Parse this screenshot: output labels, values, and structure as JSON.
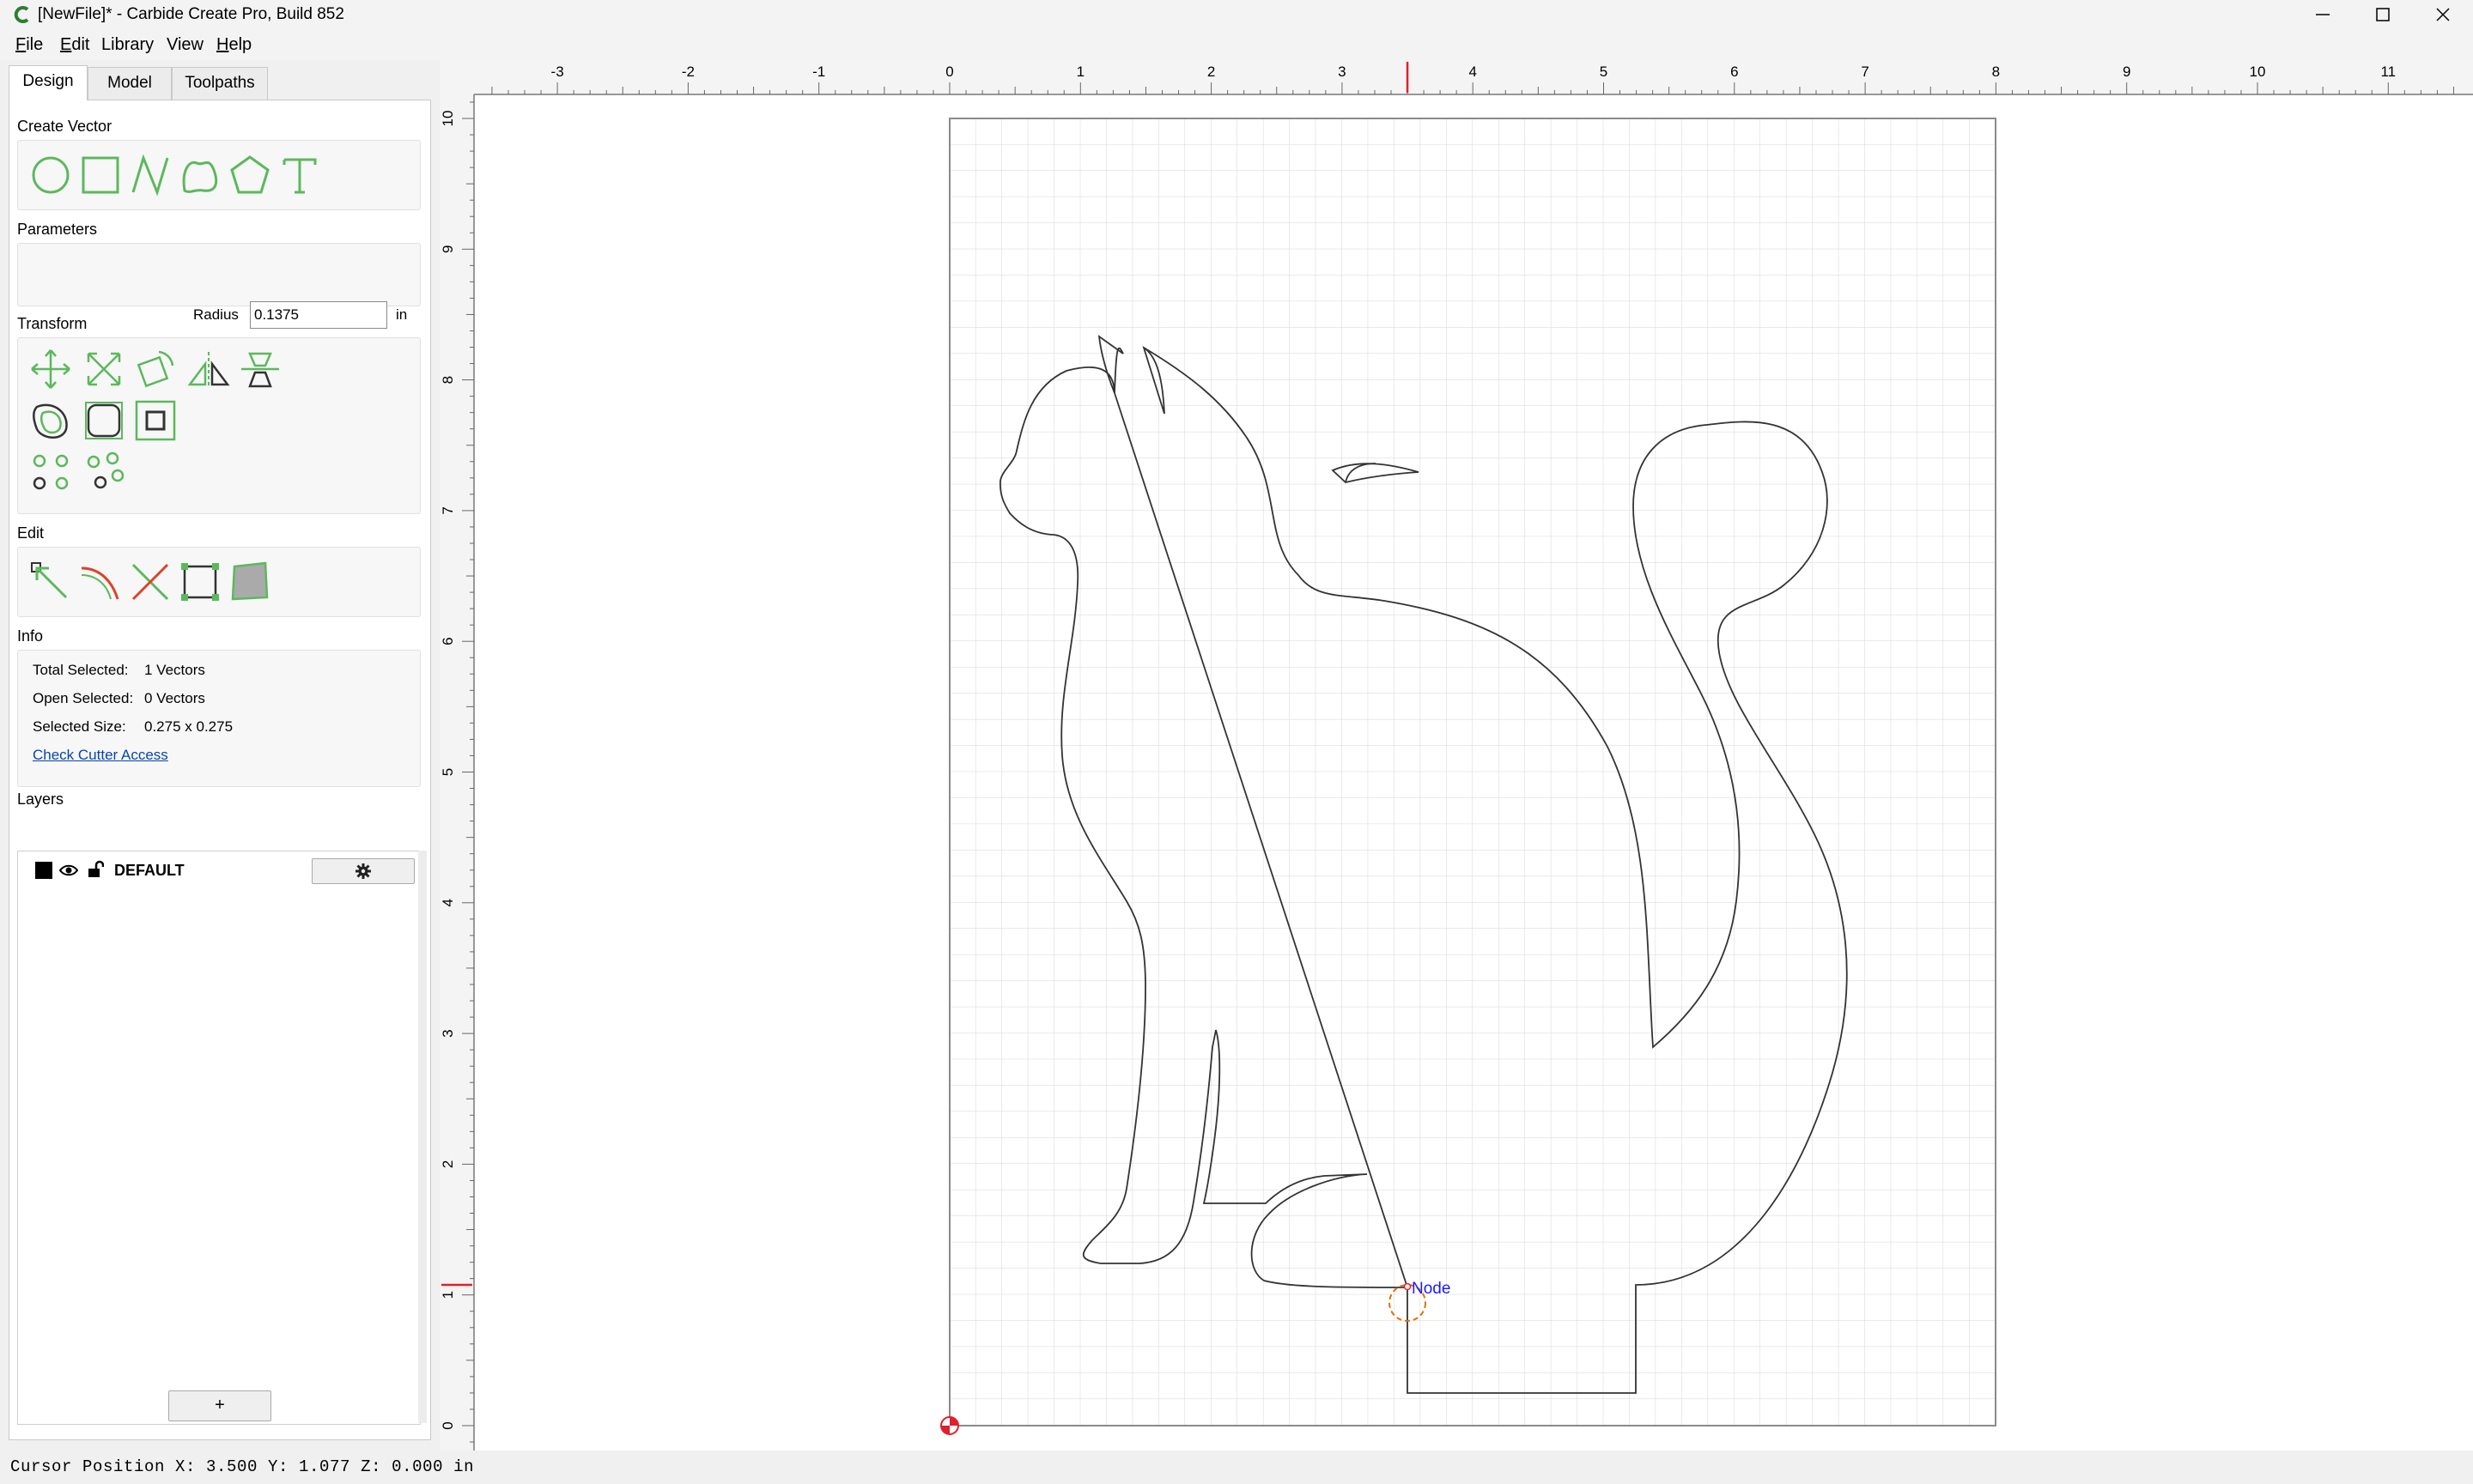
{
  "window": {
    "title": "[NewFile]* - Carbide Create Pro, Build 852"
  },
  "menu": [
    {
      "label": "File",
      "accel": "F",
      "rest": "ile"
    },
    {
      "label": "Edit",
      "accel": "E",
      "rest": "dit"
    },
    {
      "label": "Library",
      "accel": "",
      "rest": "Library"
    },
    {
      "label": "View",
      "accel": "",
      "rest": "View"
    },
    {
      "label": "Help",
      "accel": "H",
      "rest": "elp"
    }
  ],
  "tabs": [
    "Design",
    "Model",
    "Toolpaths"
  ],
  "sections": {
    "create_vector": "Create Vector",
    "parameters": "Parameters",
    "transform": "Transform",
    "edit": "Edit",
    "info": "Info",
    "layers": "Layers"
  },
  "create_vector_tools": [
    "circle-icon",
    "rectangle-icon",
    "polyline-icon",
    "curve-icon",
    "polygon-icon",
    "text-icon"
  ],
  "parameters": {
    "radius_label": "Radius",
    "radius_value": "0.1375",
    "unit": "in"
  },
  "transform_tools": [
    "move-icon",
    "scale-icon",
    "rotate-icon",
    "mirror-icon",
    "align-icon",
    "offset-icon",
    "fillet-icon",
    "boolean-icon",
    "array-icon",
    "circular-array-icon"
  ],
  "edit_tools": [
    "node-edit-icon",
    "trim-icon",
    "cut-icon",
    "bounding-box-icon",
    "smooth-icon"
  ],
  "info": {
    "total_selected_label": "Total Selected:",
    "total_selected_value": "1 Vectors",
    "open_selected_label": "Open Selected:",
    "open_selected_value": "0 Vectors",
    "selected_size_label": "Selected Size:",
    "selected_size_value": "0.275 x 0.275",
    "check_cutter_access": "Check Cutter Access"
  },
  "layers": [
    {
      "name": "DEFAULT",
      "color": "#000000"
    }
  ],
  "add_layer_label": "+",
  "ruler": {
    "x_labels": [
      "-3",
      "-2",
      "-1",
      "0",
      "1",
      "2",
      "3",
      "4",
      "5",
      "6",
      "7",
      "8",
      "9",
      "10",
      "11"
    ],
    "y_labels": [
      "10",
      "9",
      "8",
      "7",
      "6",
      "5",
      "4",
      "3",
      "2",
      "1",
      "0"
    ],
    "cursor_x": 3.5,
    "cursor_y": 1.077
  },
  "canvas": {
    "node_label": "Node"
  },
  "status": {
    "cursor_text": "Cursor Position X: 3.500 Y: 1.077 Z: 0.000 in"
  },
  "colors": {
    "accent_green": "#5cb85c",
    "cursor_red": "#e0202a",
    "node_blue": "#1a1aff",
    "selection_orange": "#e07000"
  }
}
